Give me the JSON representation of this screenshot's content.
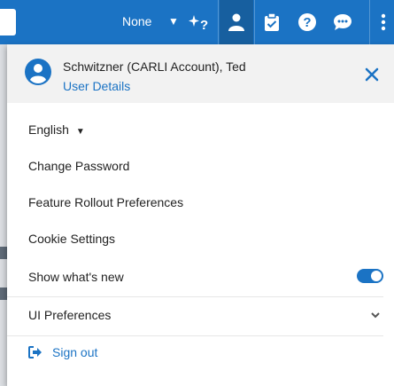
{
  "topbar": {
    "none_label": "None",
    "icons": [
      "ai-help-icon",
      "user-icon",
      "tasks-icon",
      "help-icon",
      "chat-icon",
      "more-icon"
    ]
  },
  "panel": {
    "user_name": "Schwitzner (CARLI Account), Ted",
    "user_details": "User Details",
    "language": "English",
    "items": {
      "change_password": "Change Password",
      "feature_rollout": "Feature Rollout Preferences",
      "cookie_settings": "Cookie Settings",
      "show_whats_new": "Show what's new",
      "ui_preferences": "UI Preferences"
    },
    "show_whats_new_enabled": true,
    "sign_out": "Sign out"
  },
  "colors": {
    "brand": "#1b73c4",
    "header_bg": "#f2f2f2"
  }
}
